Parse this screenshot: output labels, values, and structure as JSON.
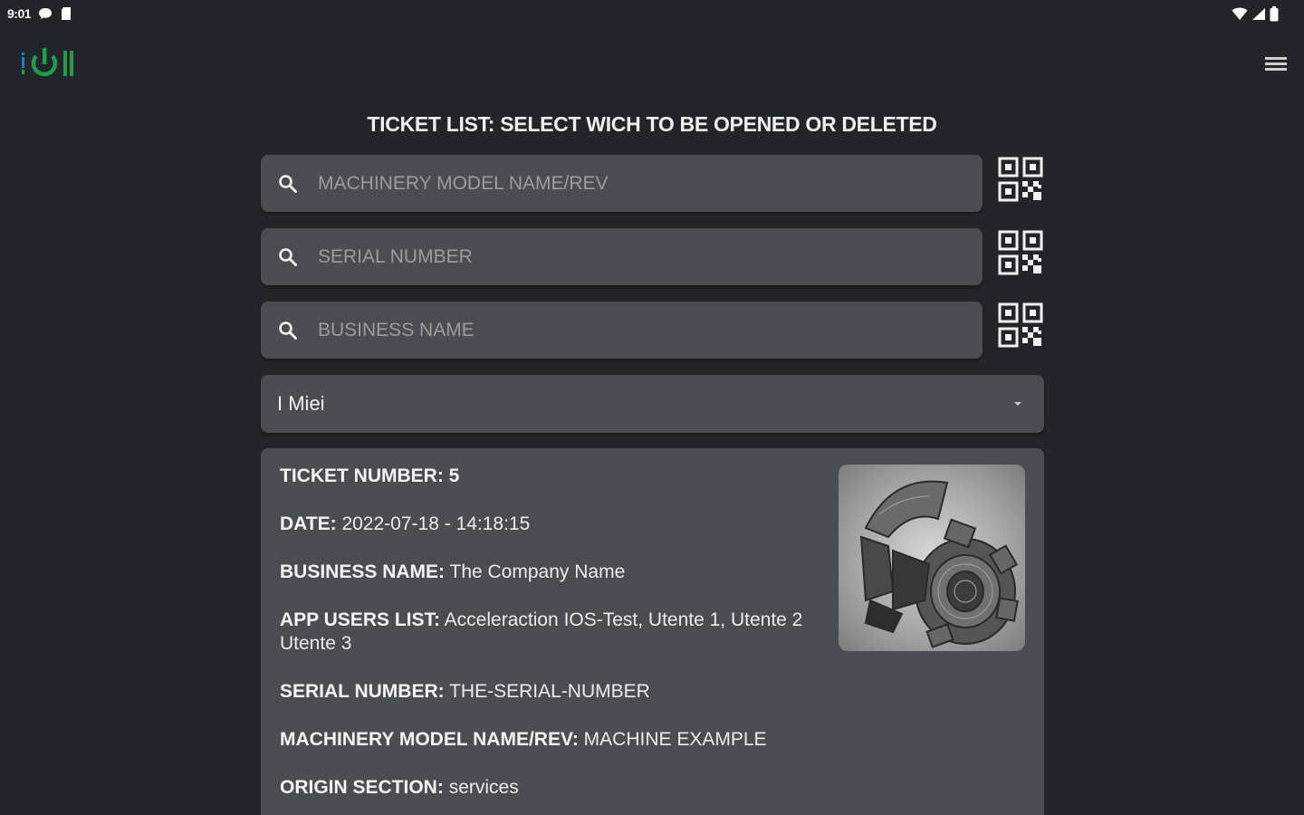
{
  "status_bar": {
    "time": "9:01"
  },
  "header": {
    "logo_icon": "power-logo-icon",
    "menu_icon": "hamburger-menu-icon"
  },
  "page": {
    "title": "TICKET LIST: SELECT WICH TO BE OPENED OR DELETED"
  },
  "search": {
    "model": {
      "placeholder": "MACHINERY MODEL NAME/REV",
      "value": ""
    },
    "serial": {
      "placeholder": "SERIAL NUMBER",
      "value": ""
    },
    "business": {
      "placeholder": "BUSINESS NAME",
      "value": ""
    }
  },
  "filter": {
    "selected": "I Miei"
  },
  "ticket": {
    "number_label": "TICKET NUMBER:",
    "number_value": "5",
    "date_label": "DATE:",
    "date_value": "2022-07-18 - 14:18:15",
    "business_label": "BUSINESS NAME:",
    "business_value": "The Company Name",
    "users_label": "APP USERS LIST:",
    "users_value": "Acceleraction IOS-Test, Utente 1, Utente 2 Utente 3",
    "serial_label": "SERIAL NUMBER:",
    "serial_value": "THE-SERIAL-NUMBER",
    "model_label": "MACHINERY MODEL NAME/REV:",
    "model_value": "MACHINE EXAMPLE",
    "origin_label": "ORIGIN SECTION:",
    "origin_value": "services"
  },
  "colors": {
    "background": "#222529",
    "field": "#4a4d52",
    "logo_green": "#1e9e4a",
    "logo_blue": "#1d7fb0"
  }
}
